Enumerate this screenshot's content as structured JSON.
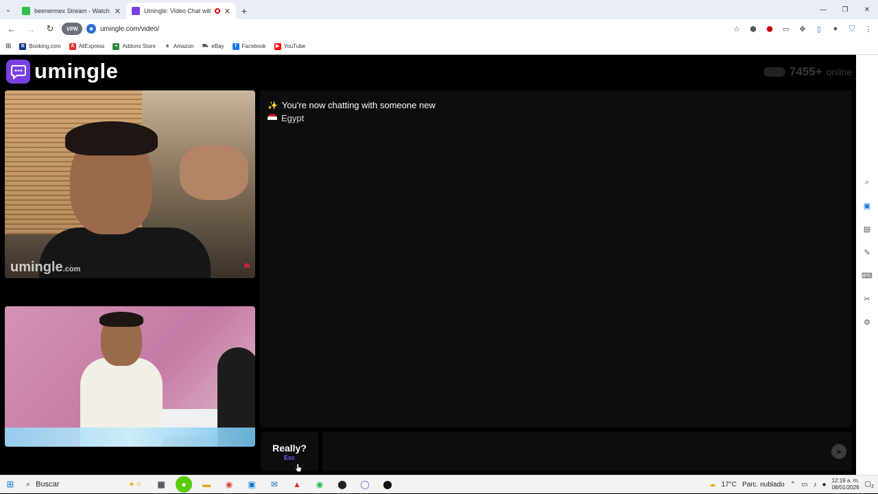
{
  "browser": {
    "tabs": [
      {
        "title": "beenermex Stream - Watch Live",
        "favicon_color": "#2fbf4a",
        "active": false
      },
      {
        "title": "Umingle: Video Chat with Str",
        "favicon_color": "#7b3fe4",
        "active": true
      }
    ],
    "url": "umingle.com/video/",
    "vpn_label": "VPN",
    "bookmarks": [
      {
        "label": "Booking.com",
        "color": "#003580",
        "letter": "B"
      },
      {
        "label": "AliExpress",
        "color": "#e43225",
        "letter": "A"
      },
      {
        "label": "Addons Store",
        "color": "#2a8a3a",
        "letter": "+"
      },
      {
        "label": "Amazon",
        "color": "#222222",
        "letter": "a"
      },
      {
        "label": "eBay",
        "color": "#555555",
        "letter": "e"
      },
      {
        "label": "Facebook",
        "color": "#1877f2",
        "letter": "f"
      },
      {
        "label": "YouTube",
        "color": "#ff0000",
        "letter": "▶"
      }
    ]
  },
  "page": {
    "brand": "umingle",
    "online_count": "7455+",
    "online_label": "online",
    "remote_watermark": "umingle",
    "remote_watermark_suffix": ".com",
    "chat": {
      "system_message": "You're now chatting with someone new",
      "country": "Egypt"
    },
    "esc_button": {
      "label": "Really?",
      "hint": "Esc"
    },
    "accent_color": "#7b3fe4"
  },
  "taskbar": {
    "search_placeholder": "Buscar",
    "weather_temp": "17°C",
    "weather_desc": "Parc. nublado",
    "time": "12:19 a. m.",
    "date": "08/01/2026",
    "notification_count": "2"
  }
}
